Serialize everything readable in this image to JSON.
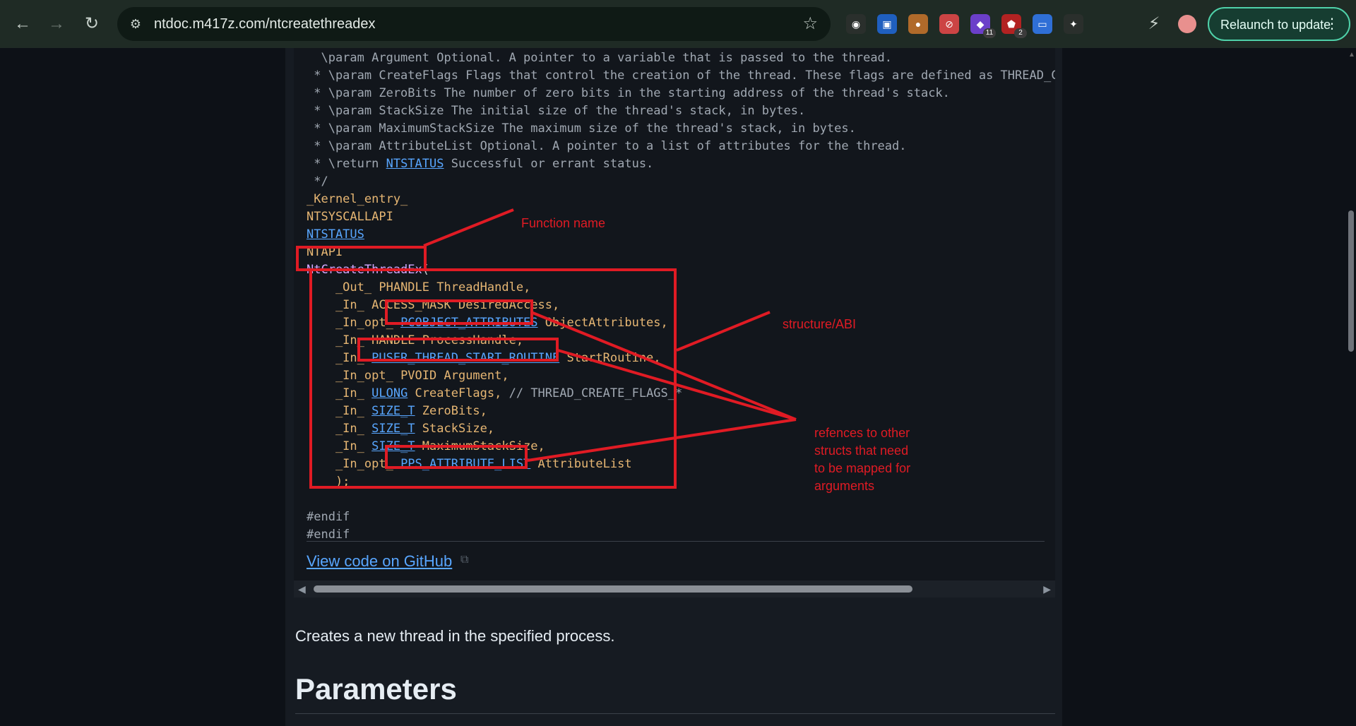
{
  "browser": {
    "url": "ntdoc.m417z.com/ntcreatethreadex",
    "relaunch_label": "Relaunch to update",
    "extensions": [
      {
        "icon": "spy-glasses-icon",
        "badge": ""
      },
      {
        "icon": "password-manager-icon",
        "badge": ""
      },
      {
        "icon": "cookie-icon",
        "badge": ""
      },
      {
        "icon": "ad-block-icon",
        "badge": ""
      },
      {
        "icon": "purple-extension-icon",
        "badge": "11"
      },
      {
        "icon": "shield-extension-icon",
        "badge": "2"
      },
      {
        "icon": "tab-manager-icon",
        "badge": ""
      },
      {
        "icon": "puzzle-icon",
        "badge": ""
      }
    ]
  },
  "code": {
    "comment_lines": [
      "  \\param Argument Optional. A pointer to a variable that is passed to the thread.",
      " * \\param CreateFlags Flags that control the creation of the thread. These flags are defined as THREAD_CREAT",
      " * \\param ZeroBits The number of zero bits in the starting address of the thread's stack.",
      " * \\param StackSize The initial size of the thread's stack, in bytes.",
      " * \\param MaximumStackSize The maximum size of the thread's stack, in bytes.",
      " * \\param AttributeList Optional. A pointer to a list of attributes for the thread."
    ],
    "return_prefix": " * \\return ",
    "return_type": "NTSTATUS",
    "return_suffix": " Successful or errant status.",
    "comment_end": " */",
    "kernel_entry": "_Kernel_entry_",
    "syscall_api": "NTSYSCALLAPI",
    "ntstatus": "NTSTATUS",
    "ntapi": "NTAPI",
    "function_name": "NtCreateThreadEx",
    "open_paren": "(",
    "params": [
      {
        "prefix": "    _Out_ ",
        "type": "PHANDLE",
        "type_link": false,
        "rest": " ThreadHandle,"
      },
      {
        "prefix": "    _In_ ",
        "type": "ACCESS_MASK",
        "type_link": false,
        "rest": " DesiredAccess,"
      },
      {
        "prefix": "    _In_opt_ ",
        "type": "PCOBJECT_ATTRIBUTES",
        "type_link": true,
        "rest": " ObjectAttributes,"
      },
      {
        "prefix": "    _In_ ",
        "type": "HANDLE",
        "type_link": false,
        "rest": " ProcessHandle,"
      },
      {
        "prefix": "    _In_ ",
        "type": "PUSER_THREAD_START_ROUTINE",
        "type_link": true,
        "rest": " StartRoutine,"
      },
      {
        "prefix": "    _In_opt_ ",
        "type": "PVOID",
        "type_link": false,
        "rest": " Argument,"
      },
      {
        "prefix": "    _In_ ",
        "type": "ULONG",
        "type_link": true,
        "rest": " CreateFlags, ",
        "comment": "// THREAD_CREATE_FLAGS_*"
      },
      {
        "prefix": "    _In_ ",
        "type": "SIZE_T",
        "type_link": true,
        "rest": " ZeroBits,"
      },
      {
        "prefix": "    _In_ ",
        "type": "SIZE_T",
        "type_link": true,
        "rest": " StackSize,"
      },
      {
        "prefix": "    _In_ ",
        "type": "SIZE_T",
        "type_link": true,
        "rest": " MaximumStackSize,"
      },
      {
        "prefix": "    _In_opt_ ",
        "type": "PPS_ATTRIBUTE_LIST",
        "type_link": true,
        "rest": " AttributeList"
      }
    ],
    "close": "    );",
    "endif1": "#endif",
    "endif2": "#endif"
  },
  "github_link": "View code on GitHub",
  "description": "Creates a new thread in the specified process.",
  "section_heading": "Parameters",
  "annotations": {
    "function_name": "Function name",
    "structure_abi": "structure/ABI",
    "references": "refences to other\nstructs that need\nto be mapped for\narguments"
  },
  "colors": {
    "annotation": "#e01b24",
    "link": "#58a6ff",
    "function": "#d2a8ff",
    "macro": "#e6b673"
  }
}
